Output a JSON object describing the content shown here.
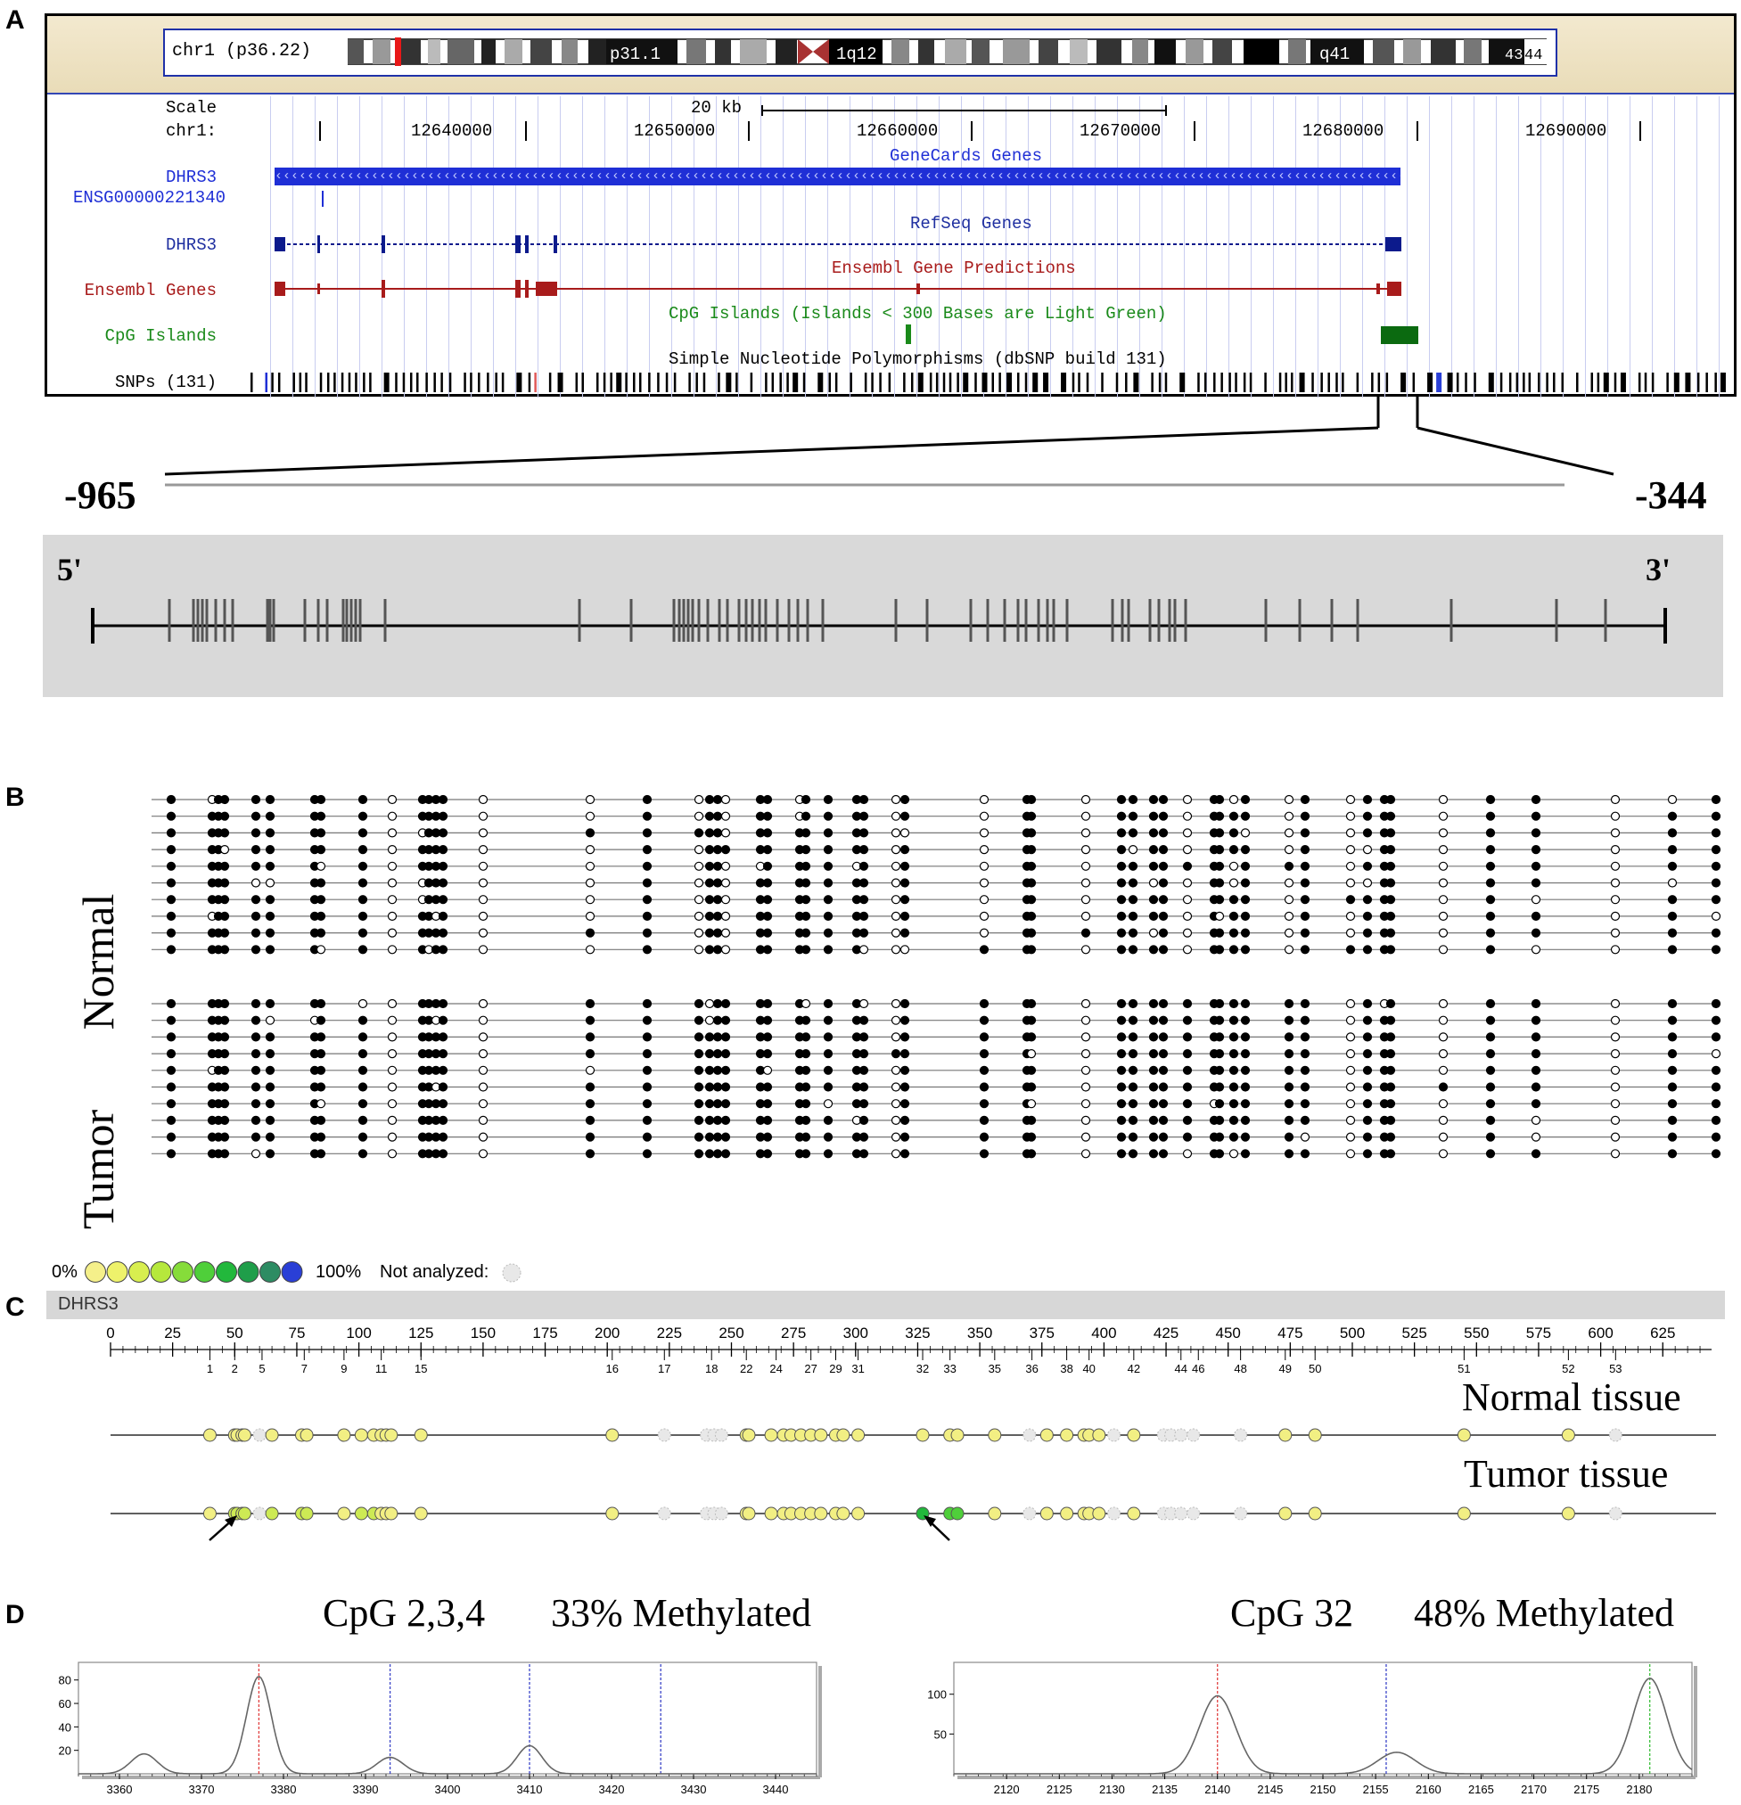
{
  "panels": {
    "a": "A",
    "b": "B",
    "c": "C",
    "d": "D"
  },
  "panel_a": {
    "chrom_label": "chr1 (p36.22)",
    "bands": [
      "p31.1",
      "1q12",
      "q41",
      "43",
      "44"
    ],
    "scale_label": "Scale",
    "chr_label": "chr1:",
    "scale_bar": "20 kb",
    "positions": [
      "12640000",
      "12650000",
      "12660000",
      "12670000",
      "12680000",
      "12690000"
    ],
    "tracks": {
      "genecards_title": "GeneCards Genes",
      "genecards_gene": "DHRS3",
      "ensg": "ENSG00000221340",
      "refseq_title": "RefSeq Genes",
      "refseq_gene": "DHRS3",
      "ensembl_label": "Ensembl Genes",
      "ensembl_title": "Ensembl Gene Predictions",
      "cpg_label": "CpG Islands",
      "cpg_title": "CpG Islands (Islands < 300 Bases are Light Green)",
      "snp_title": "Simple Nucleotide Polymorphisms (dbSNP build 131)",
      "snp_label": "SNPs (131)"
    },
    "zoom_left": "-965",
    "zoom_right": "-344",
    "five_prime": "5'",
    "three_prime": "3'"
  },
  "panel_b": {
    "normal_label": "Normal",
    "tumor_label": "Tumor"
  },
  "panel_c": {
    "legend_0": "0%",
    "legend_100": "100%",
    "not_analyzed": "Not analyzed:",
    "legend_colors": [
      "#f5f08a",
      "#eef26b",
      "#d8ee4f",
      "#b6e83c",
      "#86dc3a",
      "#4fcf3a",
      "#22b83c",
      "#1f9e4a",
      "#2d8c63",
      "#2a3fd6"
    ],
    "gene": "DHRS3",
    "axis_ticks": [
      "0",
      "25",
      "50",
      "75",
      "100",
      "125",
      "150",
      "175",
      "200",
      "225",
      "250",
      "275",
      "300",
      "325",
      "350",
      "375",
      "400",
      "425",
      "450",
      "475",
      "500",
      "525",
      "550",
      "575",
      "600",
      "625"
    ],
    "cpg_numbers": [
      [
        "1",
        40
      ],
      [
        "2",
        50
      ],
      [
        "5",
        61
      ],
      [
        "7",
        78
      ],
      [
        "9",
        94
      ],
      [
        "11",
        109
      ],
      [
        "15",
        125
      ],
      [
        "16",
        202
      ],
      [
        "17",
        223
      ],
      [
        "18",
        242
      ],
      [
        "22",
        256
      ],
      [
        "24",
        268
      ],
      [
        "27",
        282
      ],
      [
        "29",
        292
      ],
      [
        "31",
        301
      ],
      [
        "32",
        327
      ],
      [
        "33",
        338
      ],
      [
        "35",
        356
      ],
      [
        "36",
        371
      ],
      [
        "38",
        385
      ],
      [
        "40",
        394
      ],
      [
        "42",
        412
      ],
      [
        "44",
        431
      ],
      [
        "46",
        438
      ],
      [
        "48",
        455
      ],
      [
        "49",
        473
      ],
      [
        "50",
        485
      ],
      [
        "51",
        545
      ],
      [
        "52",
        587
      ],
      [
        "53",
        606
      ]
    ],
    "normal_label": "Normal tissue",
    "tumor_label": "Tumor tissue"
  },
  "panel_d": {
    "left_title": "CpG 2,3,4",
    "left_value": "33% Methylated",
    "right_title": "CpG 32",
    "right_value": "48% Methylated",
    "left_yticks": [
      "80",
      "60",
      "40",
      "20"
    ],
    "left_xticks": [
      "3360",
      "3370",
      "3380",
      "3390",
      "3400",
      "3410",
      "3420",
      "3430",
      "3440"
    ],
    "right_yticks": [
      "100",
      "50"
    ],
    "right_xticks": [
      "2120",
      "2125",
      "2130",
      "2135",
      "2140",
      "2145",
      "2150",
      "2155",
      "2160",
      "2165",
      "2170",
      "2175",
      "2180"
    ]
  }
}
